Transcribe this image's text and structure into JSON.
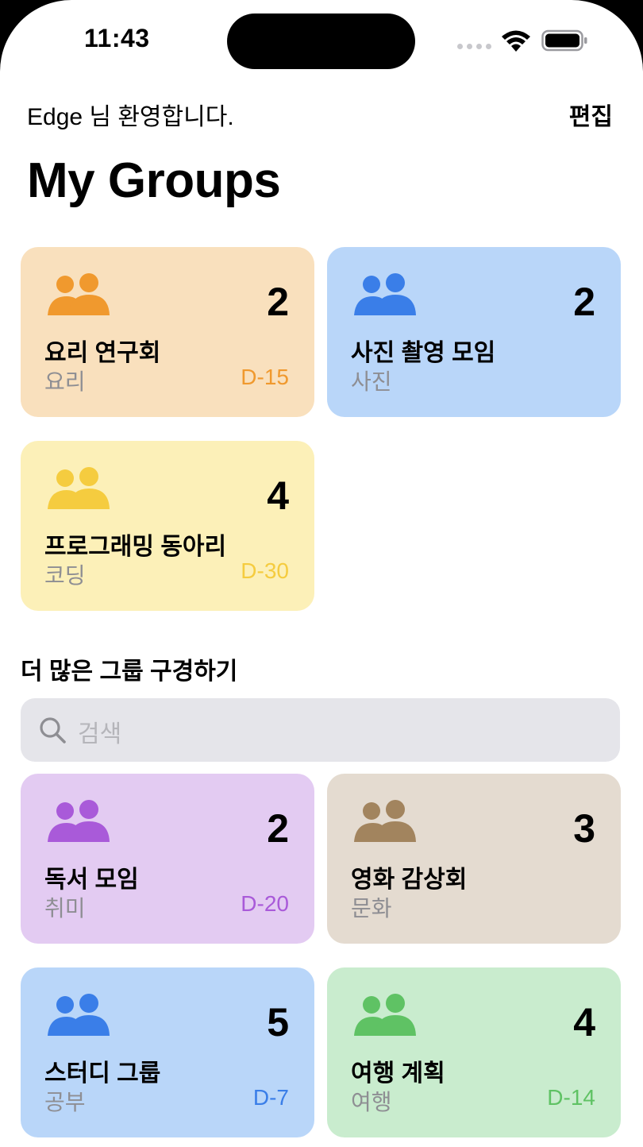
{
  "status_bar": {
    "time": "11:43"
  },
  "header": {
    "welcome": "Edge 님 환영합니다.",
    "edit_label": "편집",
    "title": "My Groups"
  },
  "my_groups": [
    {
      "name": "요리 연구회",
      "category": "요리",
      "count": "2",
      "dday": "D-15",
      "bg": "#f9e0bd",
      "accent": "#f0992e"
    },
    {
      "name": "사진 촬영 모임",
      "category": "사진",
      "count": "2",
      "dday": "",
      "bg": "#b9d6f9",
      "accent": "#3a7ee8"
    },
    {
      "name": "프로그래밍 동아리",
      "category": "코딩",
      "count": "4",
      "dday": "D-30",
      "bg": "#fcf0b8",
      "accent": "#f5cc3f"
    }
  ],
  "explore": {
    "section_title": "더 많은 그룹 구경하기",
    "search_placeholder": "검색",
    "groups": [
      {
        "name": "독서 모임",
        "category": "취미",
        "count": "2",
        "dday": "D-20",
        "bg": "#e3cbf2",
        "accent": "#a95ad9"
      },
      {
        "name": "영화 감상회",
        "category": "문화",
        "count": "3",
        "dday": "",
        "bg": "#e4dbd0",
        "accent": "#a2845e"
      },
      {
        "name": "스터디 그룹",
        "category": "공부",
        "count": "5",
        "dday": "D-7",
        "bg": "#b9d6f9",
        "accent": "#3a7ee8"
      },
      {
        "name": "여행 계획",
        "category": "여행",
        "count": "4",
        "dday": "D-14",
        "bg": "#c9ecce",
        "accent": "#5fc264"
      }
    ]
  },
  "icons": {
    "group": "people-icon",
    "search": "search-icon",
    "wifi": "wifi-icon",
    "battery": "battery-icon"
  }
}
